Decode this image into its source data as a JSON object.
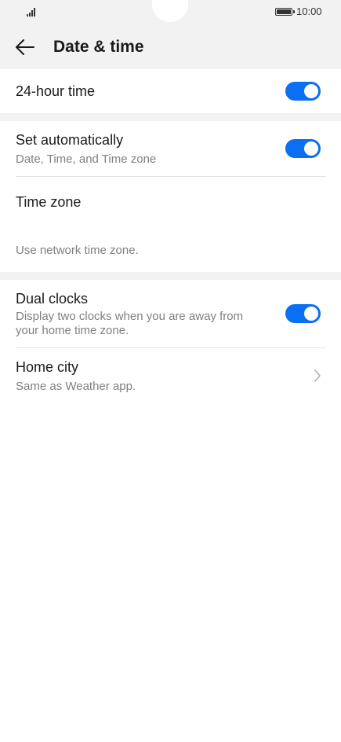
{
  "status_bar": {
    "time": "10:00",
    "icons": [
      "signal-icon",
      "battery-icon"
    ]
  },
  "header": {
    "title": "Date & time",
    "back_icon": "back-arrow-icon"
  },
  "settings": {
    "hour24": {
      "label": "24-hour time",
      "enabled": true
    },
    "set_automatically": {
      "label": "Set automatically",
      "subtitle": "Date, Time, and Time zone",
      "enabled": true
    },
    "time_zone": {
      "label": "Time zone",
      "note": "Use network time zone."
    },
    "dual_clocks": {
      "label": "Dual clocks",
      "subtitle": "Display two clocks when you are away from your home time zone.",
      "enabled": true
    },
    "home_city": {
      "label": "Home city",
      "subtitle": "Same as Weather app.",
      "icon": "chevron-right-icon"
    }
  },
  "colors": {
    "accent": "#0a6ff2",
    "background_grey": "#f2f2f2",
    "text_primary": "#1a1a1a",
    "text_secondary": "#808080"
  }
}
